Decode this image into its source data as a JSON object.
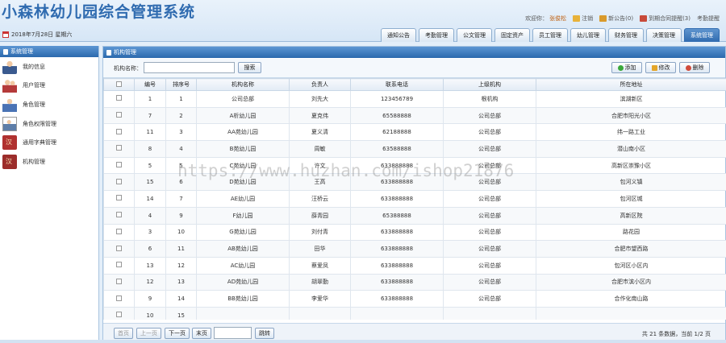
{
  "app": {
    "title": "小森林幼儿园综合管理系统",
    "date": "2018年7月28日 星期六"
  },
  "user_bar": {
    "welcome": "欢迎你：",
    "username": "张俊松",
    "logout": "注销",
    "notice": "新公告(0)",
    "contract": "到期合同提醒(3)",
    "attendance": "考勤提醒"
  },
  "nav_tabs": [
    "通知公告",
    "考勤管理",
    "公文管理",
    "固定资产",
    "员工管理",
    "幼儿管理",
    "财务管理",
    "决策管理",
    "系统管理"
  ],
  "nav_active": "系统管理",
  "sidebar": {
    "title": "系统管理",
    "items": [
      {
        "label": "我的信息",
        "icon": "user-icon"
      },
      {
        "label": "用户管理",
        "icon": "users-icon"
      },
      {
        "label": "角色管理",
        "icon": "role-icon"
      },
      {
        "label": "角色权限管理",
        "icon": "permission-icon"
      },
      {
        "label": "通用字典管理",
        "icon": "dictionary-icon"
      },
      {
        "label": "机构管理",
        "icon": "organization-icon"
      }
    ]
  },
  "main": {
    "title": "机构管理",
    "search_label": "机构名称：",
    "search_value": "",
    "search_button": "搜索",
    "add_button": "添加",
    "edit_button": "修改",
    "delete_button": "删除"
  },
  "table": {
    "headers": [
      "编号",
      "排序号",
      "机构名称",
      "负责人",
      "联系电话",
      "上级机构",
      "所在地址"
    ],
    "rows": [
      [
        "1",
        "1",
        "公司总部",
        "刘先大",
        "123456789",
        "根机构",
        "滨湖新区"
      ],
      [
        "7",
        "2",
        "A析幼儿园",
        "夏克伟",
        "65588888",
        "公司总部",
        "合肥市阳光小区"
      ],
      [
        "11",
        "3",
        "AA苑幼儿园",
        "夏义清",
        "62188888",
        "公司总部",
        "纬一路工业"
      ],
      [
        "8",
        "4",
        "B苑幼儿园",
        "周敏",
        "63588888",
        "公司总部",
        "潜山南小区"
      ],
      [
        "5",
        "5",
        "C苑幼儿园",
        "许文",
        "633888888",
        "公司总部",
        "高新区崇豫小区"
      ],
      [
        "15",
        "6",
        "D苑幼儿园",
        "王高",
        "633888888",
        "公司总部",
        "包河义镇"
      ],
      [
        "14",
        "7",
        "AE幼儿园",
        "汪桥云",
        "633888888",
        "公司总部",
        "包河区城"
      ],
      [
        "4",
        "9",
        "F幼儿园",
        "薛青园",
        "65388888",
        "公司总部",
        "高新区院"
      ],
      [
        "3",
        "10",
        "G苑幼儿园",
        "刘付青",
        "633888888",
        "公司总部",
        "路花园"
      ],
      [
        "6",
        "11",
        "AB苑幼儿园",
        "田华",
        "633888888",
        "公司总部",
        "合肥市望西路"
      ],
      [
        "13",
        "12",
        "AC幼儿园",
        "蔡爱凤",
        "633888888",
        "公司总部",
        "包河区小区内"
      ],
      [
        "12",
        "13",
        "AD苑幼儿园",
        "胡翠勤",
        "633888888",
        "公司总部",
        "合肥市滨小区内"
      ],
      [
        "9",
        "14",
        "BB苑幼儿园",
        "李爱华",
        "633888888",
        "公司总部",
        "合作化南山路"
      ],
      [
        "10",
        "15",
        "",
        "",
        "",
        "",
        ""
      ]
    ]
  },
  "pager": {
    "first": "首页",
    "prev": "上一页",
    "next": "下一页",
    "last": "末页",
    "page_value": "",
    "jump": "跳转",
    "info": "共 21 条数据，当前 1/2 页"
  },
  "watermark": "https://www.huzhan.com/ishop21876"
}
